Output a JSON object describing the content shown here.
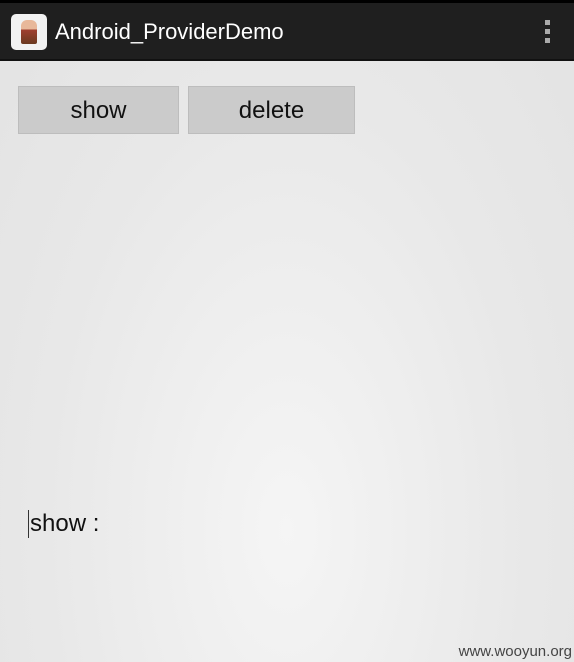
{
  "app": {
    "title": "Android_ProviderDemo",
    "icon": "app-icon"
  },
  "buttons": {
    "show": "show",
    "delete": "delete"
  },
  "output": {
    "text": "show :"
  },
  "watermark": "www.wooyun.org"
}
